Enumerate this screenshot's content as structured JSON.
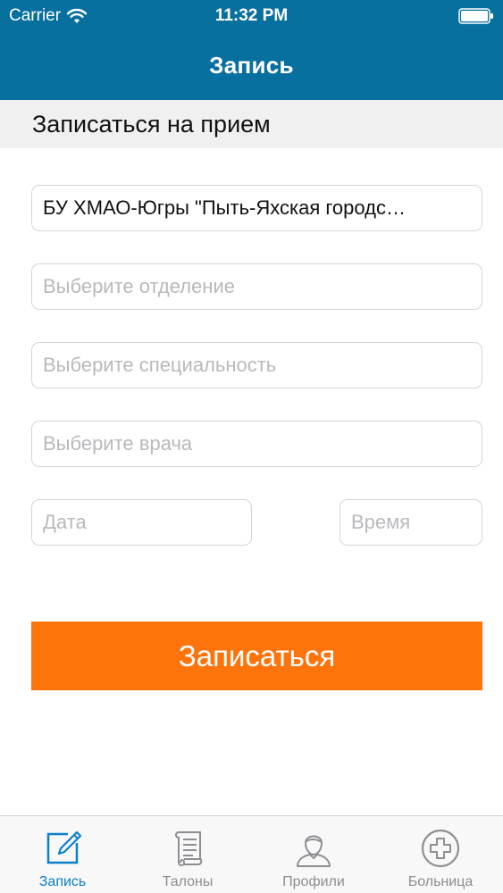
{
  "status_bar": {
    "carrier": "Carrier",
    "time": "11:32 PM"
  },
  "nav": {
    "title": "Запись"
  },
  "section": {
    "title": "Записаться на прием"
  },
  "form": {
    "hospital_value": "БУ ХМАО-Югры \"Пыть-Яхская городс…",
    "department_placeholder": "Выберите отделение",
    "specialty_placeholder": "Выберите специальность",
    "doctor_placeholder": "Выберите врача",
    "date_placeholder": "Дата",
    "time_placeholder": "Время",
    "submit_label": "Записаться"
  },
  "tabs": [
    {
      "label": "Запись",
      "icon": "edit-icon",
      "active": true
    },
    {
      "label": "Талоны",
      "icon": "scroll-icon",
      "active": false
    },
    {
      "label": "Профили",
      "icon": "user-icon",
      "active": false
    },
    {
      "label": "Больница",
      "icon": "plus-circle-icon",
      "active": false
    }
  ],
  "colors": {
    "nav_bar": "#08709f",
    "accent_button": "#fd740c",
    "tab_active": "#0a80c9",
    "tab_inactive": "#8e8e93"
  }
}
